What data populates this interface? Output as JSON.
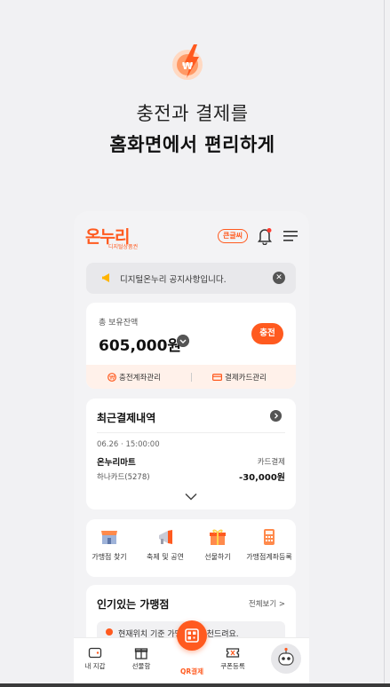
{
  "hero": {
    "line1": "충전과 결제를",
    "line2": "홈화면에서 편리하게",
    "icon": "won-coin-lightning-icon"
  },
  "app": {
    "logo_main": "온누리",
    "logo_sub": "디지털상품권",
    "bigtext_label": "큰글씨",
    "notice": "디지털온누리 공지사항입니다.",
    "balance": {
      "label": "총 보유잔액",
      "amount": "605,000원",
      "charge_label": "충전",
      "account_manage": "충전계좌관리",
      "card_manage": "결제카드관리"
    },
    "recent": {
      "title": "최근결제내역",
      "date": "06.26 · 15:00:00",
      "store": "온누리마트",
      "pay_type": "카드결제",
      "card": "하나카드(5278)",
      "amount": "-30,000원"
    },
    "quick_menu": [
      {
        "label": "가맹점 찾기"
      },
      {
        "label": "축제 및 공연"
      },
      {
        "label": "선물하기"
      },
      {
        "label": "가맹점계좌등록"
      }
    ],
    "popular": {
      "title": "인기있는 가맹점",
      "view_all": "전체보기 >",
      "location_text": "현재위치 기준 가맹점을 추천드려요."
    },
    "nav": {
      "wallet": "내 지갑",
      "gift_box": "선물함",
      "qr_pay": "QR결제",
      "coupon": "쿠폰등록"
    }
  },
  "colors": {
    "accent": "#ff5a1f",
    "background": "#f1f1f3"
  }
}
